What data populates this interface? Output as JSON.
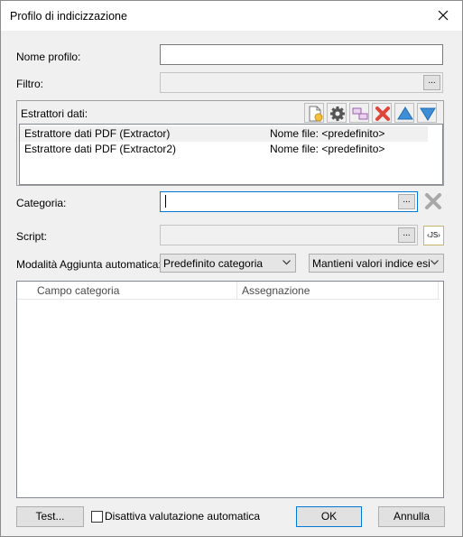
{
  "window": {
    "title": "Profilo di indicizzazione"
  },
  "form": {
    "profile_name_label": "Nome profilo:",
    "profile_name_value": "",
    "filter_label": "Filtro:",
    "filter_value": "",
    "ellipsis": "...",
    "extractors_label": "Estrattori dati:",
    "extractors": [
      {
        "name": "Estrattore dati PDF (Extractor)",
        "file": "Nome file: <predefinito>"
      },
      {
        "name": "Estrattore dati PDF (Extractor2)",
        "file": "Nome file: <predefinito>"
      }
    ],
    "category_label": "Categoria:",
    "category_value": "",
    "script_label": "Script:",
    "script_value": "",
    "js_badge": "‹JS›",
    "auto_add_label": "Modalità Aggiunta automatica:",
    "auto_add_mode": "Predefinito categoria",
    "keep_values_mode": "Mantieni valori indice esistenti",
    "grid_columns": [
      "Campo categoria",
      "Assegnazione"
    ]
  },
  "footer": {
    "test_label": "Test...",
    "disable_eval_label": "Disattiva valutazione automatica",
    "disable_eval_checked": false,
    "ok_label": "OK",
    "cancel_label": "Annulla"
  },
  "colors": {
    "accent": "#0078d7",
    "delete_red": "#e0453a",
    "arrow_blue": "#3f8fd6"
  }
}
